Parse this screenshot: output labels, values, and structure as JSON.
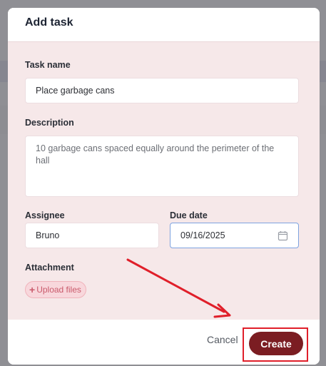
{
  "modal": {
    "title": "Add task"
  },
  "form": {
    "task_name": {
      "label": "Task name",
      "value": "Place garbage cans"
    },
    "description": {
      "label": "Description",
      "value": "10 garbage cans spaced equally around the perimeter of the hall"
    },
    "assignee": {
      "label": "Assignee",
      "value": "Bruno"
    },
    "due_date": {
      "label": "Due date",
      "value": "09/16/2025",
      "icon": "calendar-icon"
    },
    "attachment": {
      "label": "Attachment",
      "upload_label": "Upload files",
      "upload_icon": "plus-icon"
    }
  },
  "footer": {
    "cancel_label": "Cancel",
    "create_label": "Create"
  },
  "colors": {
    "accent": "#7b1d22",
    "annotation": "#e01f2a",
    "body_bg": "#f6e8e9"
  }
}
